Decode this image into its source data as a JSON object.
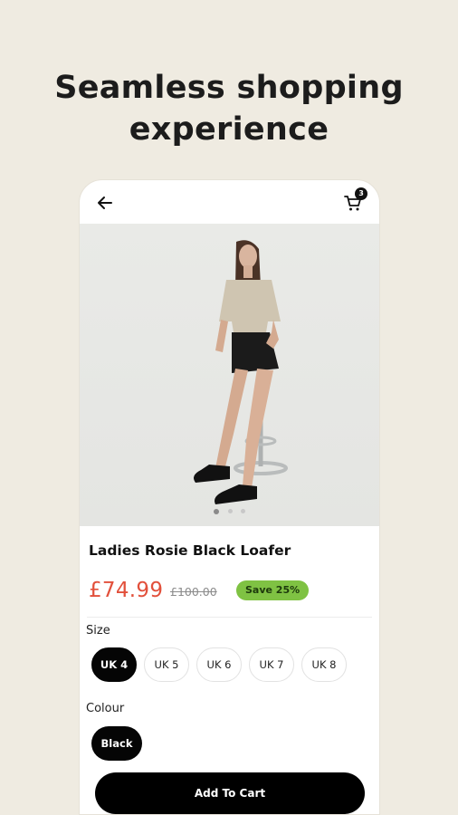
{
  "headline": {
    "line1": "Seamless shopping",
    "line2": "experience"
  },
  "topbar": {
    "back_icon": "arrow-left-icon",
    "cart_icon": "cart-icon",
    "cart_count": "3"
  },
  "product": {
    "title": "Ladies Rosie Black Loafer",
    "price": "£74.99",
    "old_price": "£100.00",
    "save_badge": "Save 25%",
    "image_count": 3,
    "active_image_index": 0
  },
  "size": {
    "label": "Size",
    "options": [
      "UK 4",
      "UK 5",
      "UK 6",
      "UK 7",
      "UK 8"
    ],
    "selected": "UK 4"
  },
  "colour": {
    "label": "Colour",
    "options": [
      "Black"
    ],
    "selected": "Black"
  },
  "cta": {
    "add_to_cart_label": "Add To Cart"
  },
  "colors": {
    "background": "#efebe1",
    "price": "#e2503b",
    "save_badge": "#7fc243",
    "primary": "#000000"
  }
}
